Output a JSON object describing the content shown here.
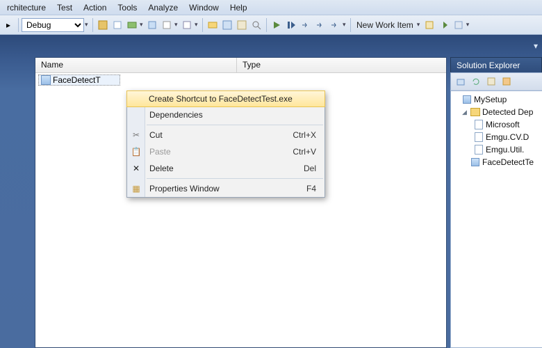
{
  "menu": {
    "items": [
      "rchitecture",
      "Test",
      "Action",
      "Tools",
      "Analyze",
      "Window",
      "Help"
    ]
  },
  "toolbar": {
    "config": "Debug",
    "team_label": "New Work Item"
  },
  "main": {
    "columns": {
      "name": "Name",
      "type": "Type"
    },
    "rows": [
      {
        "name": "FaceDetectT",
        "type": ""
      }
    ]
  },
  "context_menu": {
    "create_shortcut": "Create Shortcut to FaceDetectTest.exe",
    "dependencies": "Dependencies",
    "cut": "Cut",
    "cut_sc": "Ctrl+X",
    "paste": "Paste",
    "paste_sc": "Ctrl+V",
    "delete": "Delete",
    "delete_sc": "Del",
    "properties": "Properties Window",
    "properties_sc": "F4"
  },
  "solution_explorer": {
    "title": "Solution Explorer",
    "root": "MySetup",
    "detected": "Detected Dep",
    "items": [
      "Microsoft ",
      "Emgu.CV.D",
      "Emgu.Util."
    ],
    "output": "FaceDetectTe"
  }
}
